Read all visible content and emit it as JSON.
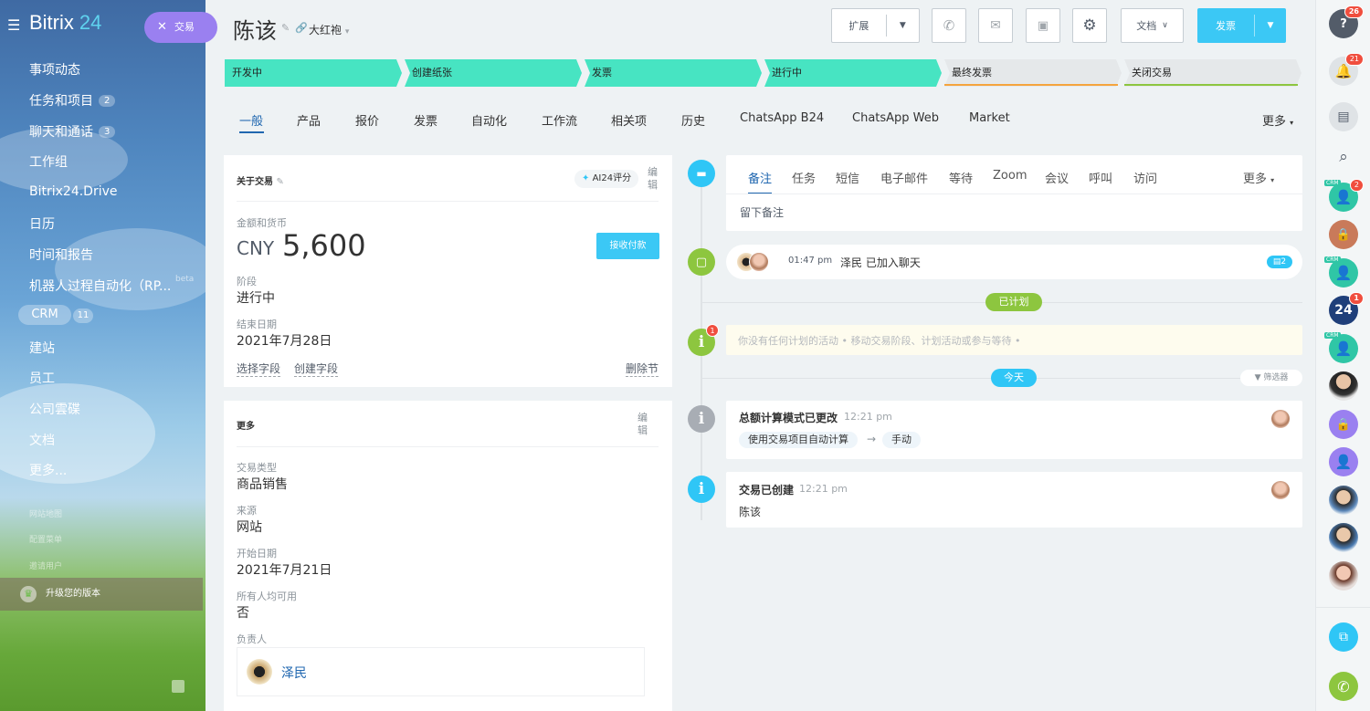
{
  "sidebar": {
    "logo": "Bitrix",
    "logo_num": "24",
    "deal_pill": "交易",
    "items": [
      {
        "label": "事项动态"
      },
      {
        "label": "任务和项目",
        "count": "2"
      },
      {
        "label": "聊天和通话",
        "count": "3"
      },
      {
        "label": "工作组"
      },
      {
        "label": "Bitrix24.Drive"
      },
      {
        "label": "日历"
      },
      {
        "label": "时间和报告"
      },
      {
        "label": "机器人过程自动化（RP...",
        "suffix": "beta"
      },
      {
        "label": "CRM",
        "count": "11"
      },
      {
        "label": "建站"
      },
      {
        "label": "员工"
      },
      {
        "label": "公司雲碟"
      },
      {
        "label": "文档"
      },
      {
        "label": "更多..."
      }
    ],
    "small_links": [
      "网站地图",
      "配置菜单",
      "邀请用户"
    ],
    "upgrade": "升级您的版本"
  },
  "header": {
    "title": "陈该",
    "tag": "大红袍",
    "expand": "扩展",
    "docs": "文档",
    "invoice": "发票"
  },
  "stages": [
    "开发中",
    "创建纸张",
    "发票",
    "进行中",
    "最终发票",
    "关闭交易"
  ],
  "tabs": [
    "一般",
    "产品",
    "报价",
    "发票",
    "自动化",
    "工作流",
    "相关项",
    "历史",
    "ChatsApp B24",
    "ChatsApp Web",
    "Market"
  ],
  "tabs_more": "更多",
  "about": {
    "title": "关于交易",
    "ai": "AI24评分",
    "edit": "编辑",
    "amount_label": "金额和货币",
    "currency": "CNY",
    "amount": "5,600",
    "pay_btn": "接收付款",
    "stage_label": "阶段",
    "stage_val": "进行中",
    "end_label": "结束日期",
    "end_val": "2021年7月28日",
    "select_field": "选择字段",
    "create_field": "创建字段",
    "delete_section": "删除节"
  },
  "more": {
    "title": "更多",
    "edit": "编辑",
    "type_label": "交易类型",
    "type_val": "商品销售",
    "source_label": "来源",
    "source_val": "网站",
    "start_label": "开始日期",
    "start_val": "2021年7月21日",
    "all_label": "所有人均可用",
    "all_val": "否",
    "resp_label": "负责人",
    "resp_val": "泽民"
  },
  "timeline": {
    "tabs": [
      "备注",
      "任务",
      "短信",
      "电子邮件",
      "等待",
      "Zoom",
      "会议",
      "呼叫",
      "访问"
    ],
    "more": "更多",
    "note_placeholder": "留下备注",
    "chat_time": "01:47 pm",
    "chat_text": "泽民 已加入聊天",
    "chat_count": "2",
    "planned": "已计划",
    "no_activity": "你没有任何计划的活动 • 移动交易阶段、计划活动或参与等待 •",
    "info_badge": "1",
    "today": "今天",
    "filter": "筛选器",
    "ev1_title": "总额计算模式已更改",
    "ev1_time": "12:21 pm",
    "ev1_from": "使用交易项目自动计算",
    "ev1_to": "手动",
    "ev2_title": "交易已创建",
    "ev2_time": "12:21 pm",
    "ev2_text": "陈该"
  },
  "rail": {
    "help_badge": "26",
    "bell_badge": "21",
    "crm_badge": "2",
    "b24_badge": "1",
    "b24": "24",
    "crm_tag": "CRM"
  },
  "colors": {
    "accent": "#3bc8f5",
    "stage_done": "#47e4c2",
    "stage_todo": "#e8ebed",
    "green": "#8dc63f",
    "purple": "#9a80f0"
  }
}
